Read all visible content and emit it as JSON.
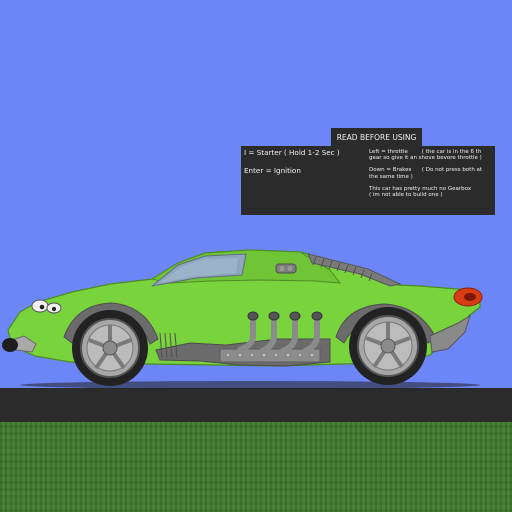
{
  "hud": {
    "title": "READ BEFORE USING",
    "left_lines": [
      "I = Starter ( Hold 1-2 Sec )",
      "Enter = Ignition"
    ],
    "right_lines": [
      "Left = throttle        ( the car is in the 6 th",
      "gear so give it an shove bevore throttle )",
      "Down = Brakes      ( Do not press both at",
      "the same time )",
      "This car has pretty much no Gearbox",
      "( im not able to build one )"
    ]
  },
  "colors": {
    "sky": "#6d86f7",
    "car_body": "#78d33d",
    "road": "#2b2b2b",
    "grass": "#3f7a2a"
  }
}
